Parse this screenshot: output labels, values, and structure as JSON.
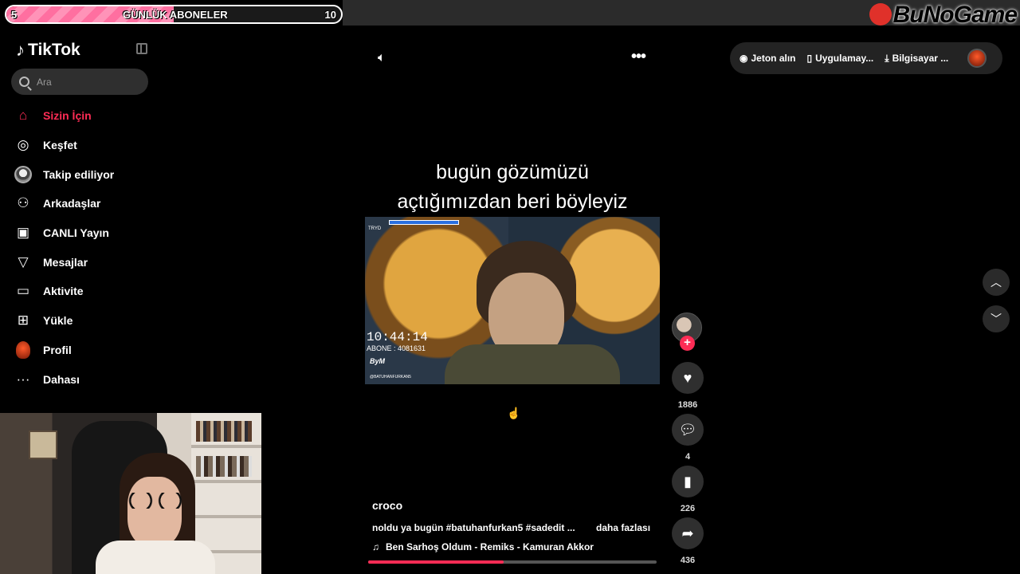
{
  "overlay": {
    "sub_goal": {
      "start": "5",
      "title": "GÜNLÜK ABONELER",
      "goal": "10",
      "progress": 0.5
    },
    "watermark": "BuNoGame"
  },
  "sidebar": {
    "brand": "TikTok",
    "search_placeholder": "Ara",
    "items": [
      {
        "label": "Sizin İçin",
        "icon": "home-icon",
        "active": true
      },
      {
        "label": "Keşfet",
        "icon": "compass-icon"
      },
      {
        "label": "Takip ediliyor",
        "icon": "avatar-icon"
      },
      {
        "label": "Arkadaşlar",
        "icon": "friends-icon"
      },
      {
        "label": "CANLI Yayın",
        "icon": "live-icon"
      },
      {
        "label": "Mesajlar",
        "icon": "send-icon"
      },
      {
        "label": "Aktivite",
        "icon": "activity-icon"
      },
      {
        "label": "Yükle",
        "icon": "upload-icon"
      },
      {
        "label": "Profil",
        "icon": "profile-avatar-icon"
      },
      {
        "label": "Dahası",
        "icon": "more-dots-icon"
      }
    ]
  },
  "topbar": {
    "coins": "Jeton alın",
    "app": "Uygulamay...",
    "desktop": "Bilgisayar ..."
  },
  "video": {
    "caption_line1": "bugün gözümüzü",
    "caption_line2": "açtığımızdan beri böyleyiz",
    "clip_overlay": {
      "top_text": "TRYD",
      "clock": "10:44:14",
      "subs": "ABONE : 4081631",
      "handle": "@BATUHANFURKAN5"
    },
    "author": "croco",
    "description": "noldu ya bugün #batuhanfurkan5 #sadedit ...",
    "more": "daha fazlası",
    "music": "Ben Sarhoş Oldum - Remiks - Kamuran Akkor",
    "progress": 0.47
  },
  "actions": {
    "likes": "1886",
    "comments": "4",
    "saves": "226",
    "shares": "436"
  },
  "colors": {
    "accent": "#fe2c55",
    "background": "#000000"
  }
}
